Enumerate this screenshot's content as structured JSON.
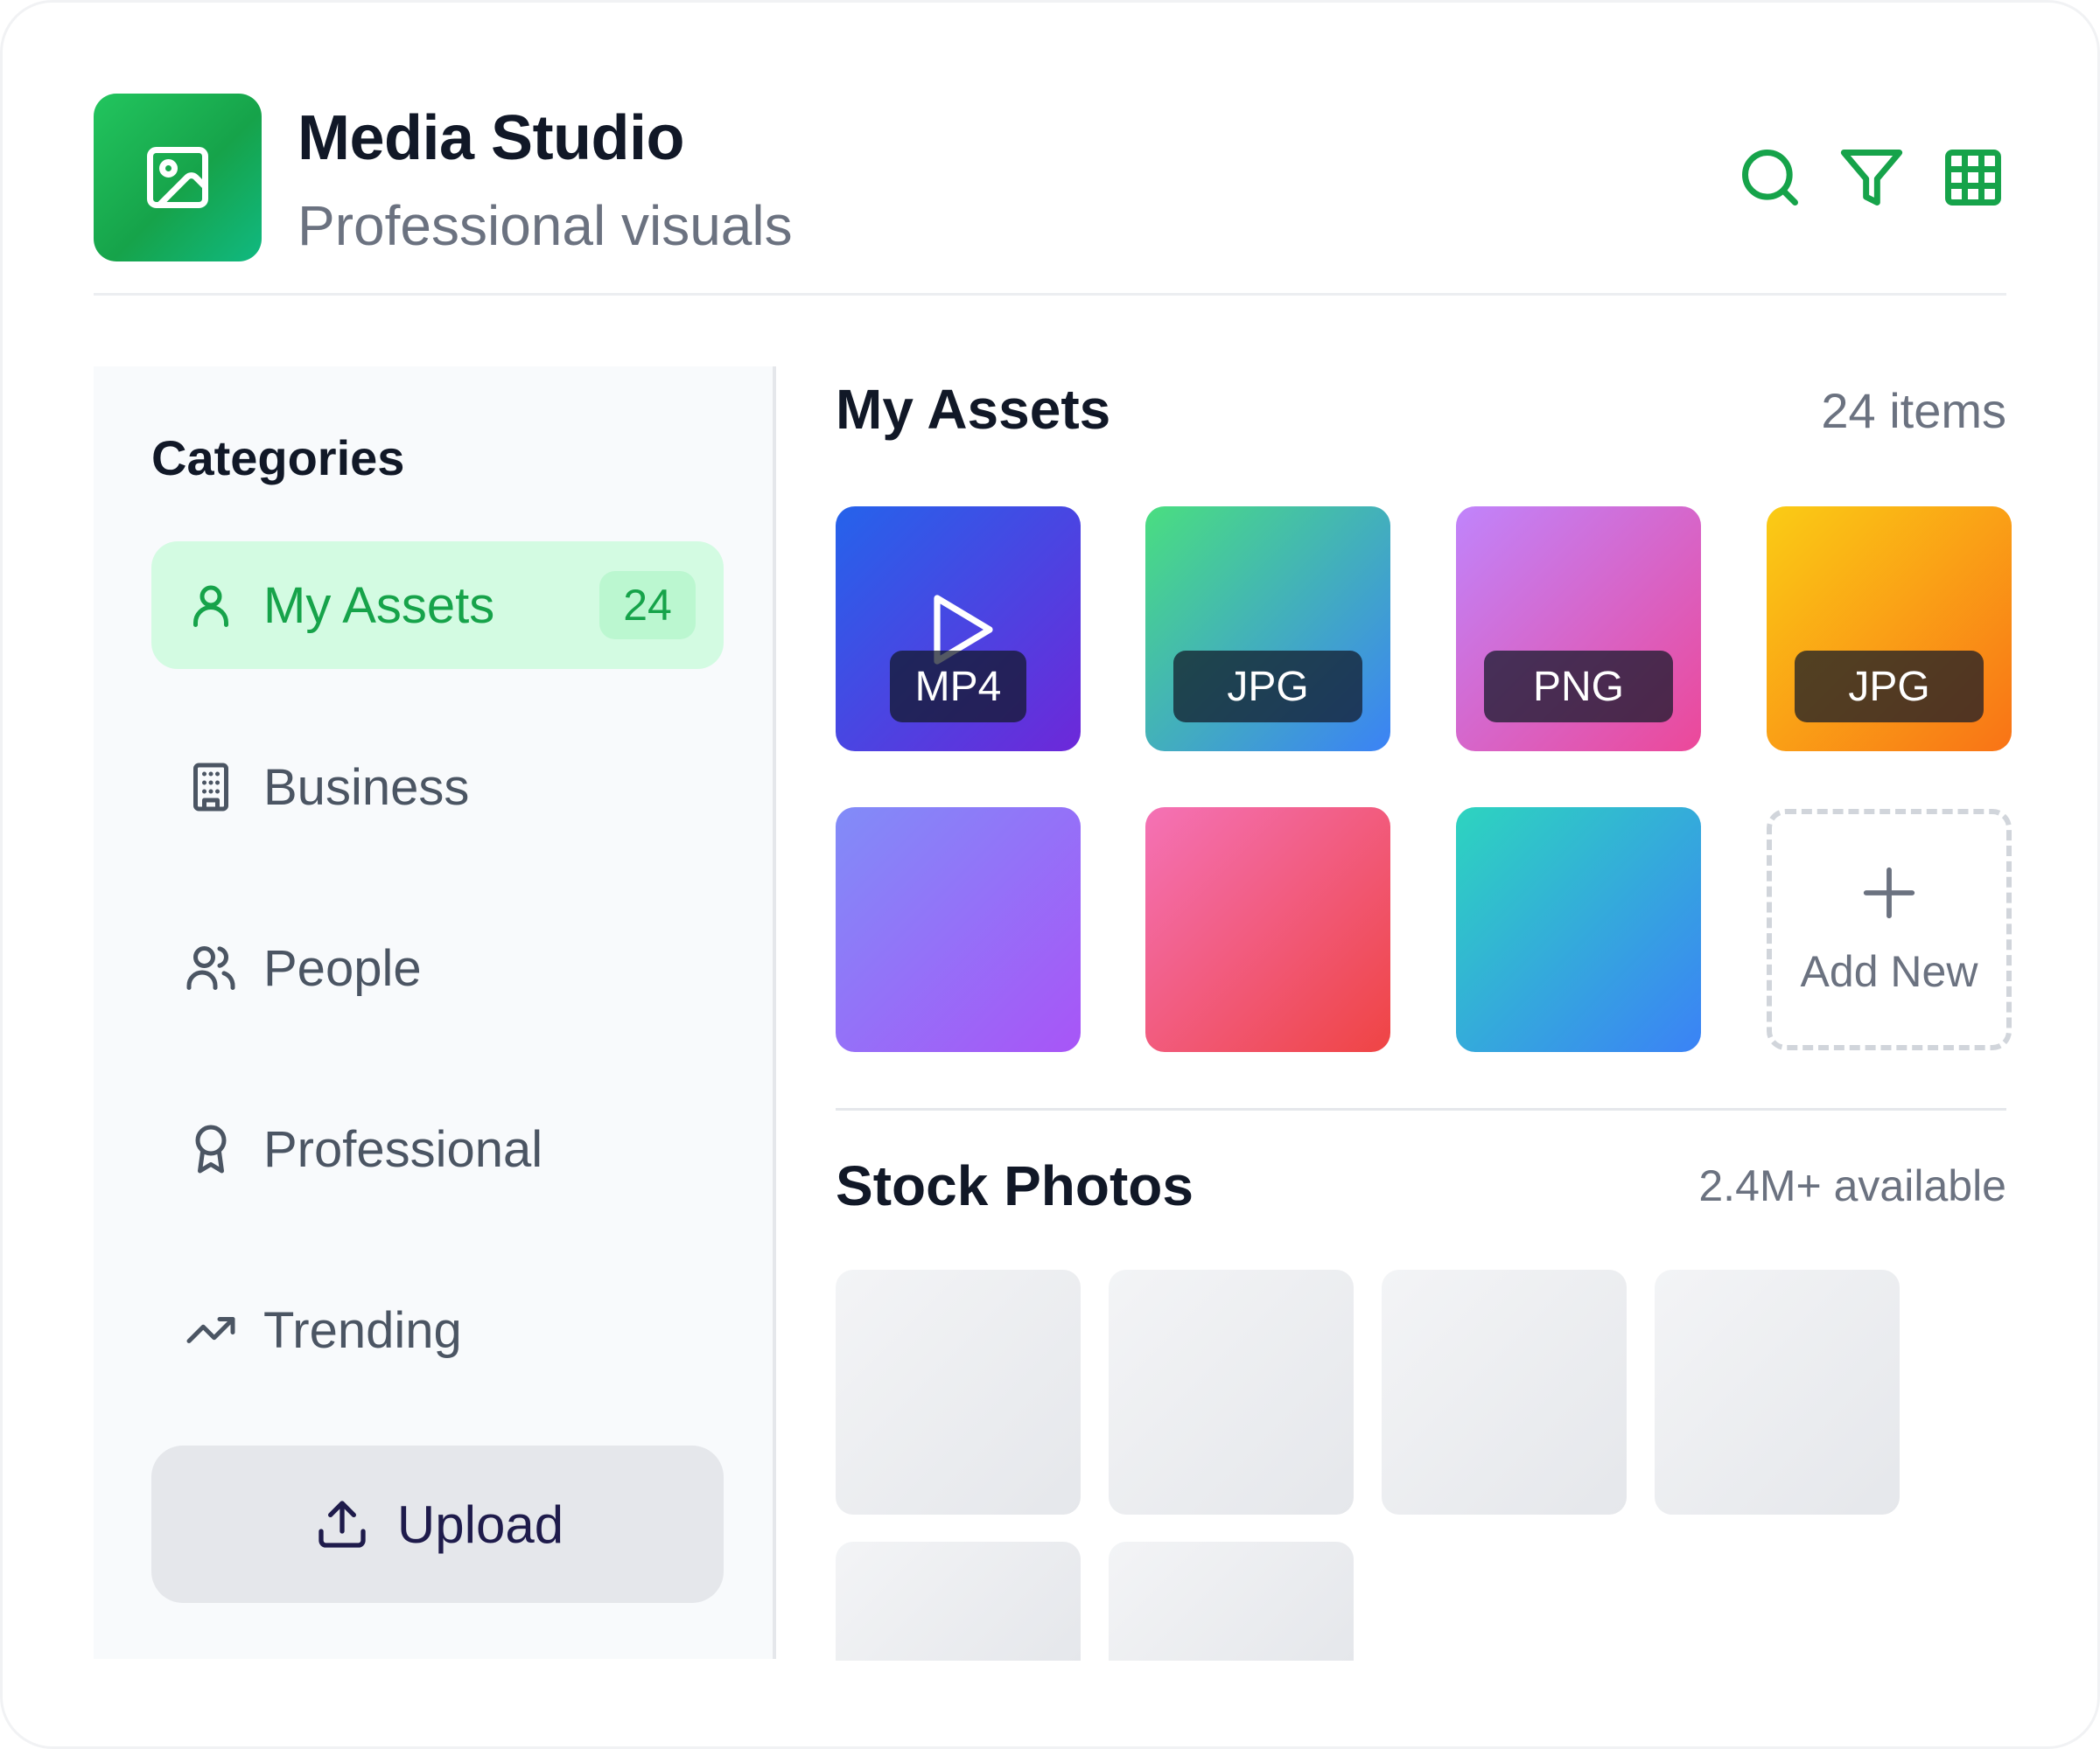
{
  "app": {
    "title": "Media Studio",
    "subtitle": "Professional visuals",
    "accent_color": "#16a34a",
    "header_icons": [
      "search-icon",
      "filter-icon",
      "grid-icon"
    ]
  },
  "sidebar": {
    "heading": "Categories",
    "items": [
      {
        "label": "My Assets",
        "icon": "user-icon",
        "badge": "24",
        "active": true
      },
      {
        "label": "Business",
        "icon": "building-icon",
        "active": false
      },
      {
        "label": "People",
        "icon": "users-icon",
        "active": false
      },
      {
        "label": "Professional",
        "icon": "award-icon",
        "active": false
      },
      {
        "label": "Trending",
        "icon": "trending-up-icon",
        "active": false
      }
    ],
    "upload_label": "Upload"
  },
  "assets": {
    "title": "My Assets",
    "count": "24 items",
    "tiles": [
      {
        "badge": "MP4",
        "video": true,
        "colors": [
          "#2563eb",
          "#6d28d9"
        ]
      },
      {
        "badge": "JPG",
        "colors": [
          "#4ade80",
          "#3b82f6"
        ]
      },
      {
        "badge": "PNG",
        "colors": [
          "#c084fc",
          "#ec4899"
        ]
      },
      {
        "badge": "JPG",
        "colors": [
          "#facc15",
          "#f97316"
        ]
      },
      {
        "badge": "",
        "colors": [
          "#818cf8",
          "#a855f7"
        ]
      },
      {
        "badge": "",
        "colors": [
          "#f472b6",
          "#ef4444"
        ]
      },
      {
        "badge": "",
        "colors": [
          "#2dd4bf",
          "#3b82f6"
        ]
      }
    ],
    "add_new_label": "Add New"
  },
  "stock": {
    "title": "Stock Photos",
    "available": "2.4M+ available"
  }
}
